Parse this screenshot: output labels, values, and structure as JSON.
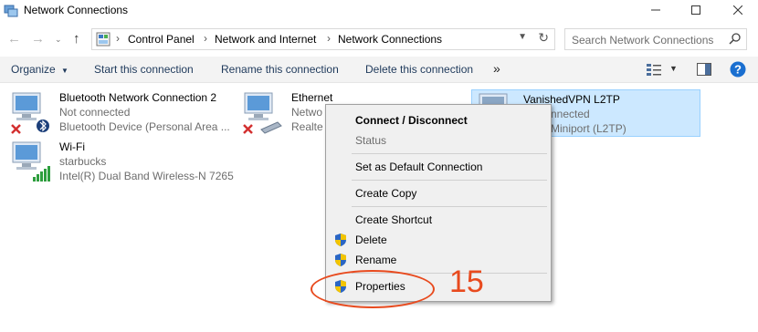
{
  "window": {
    "title": "Network Connections"
  },
  "breadcrumb": [
    "Control Panel",
    "Network and Internet",
    "Network Connections"
  ],
  "search": {
    "placeholder": "Search Network Connections",
    "value": ""
  },
  "toolbar": {
    "organize": "Organize",
    "start": "Start this connection",
    "rename": "Rename this connection",
    "delete": "Delete this connection",
    "more": "»"
  },
  "connections": [
    {
      "name": "Bluetooth Network Connection 2",
      "status": "Not connected",
      "device": "Bluetooth Device (Personal Area ..."
    },
    {
      "name": "Ethernet",
      "status": "Netwo",
      "device": "Realte"
    },
    {
      "name": "VanishedVPN L2TP",
      "status": "nnected",
      "device": "Miniport (L2TP)"
    },
    {
      "name": "Wi-Fi",
      "status": "starbucks",
      "device": "Intel(R) Dual Band Wireless-N 7265"
    }
  ],
  "context_menu": {
    "connect": "Connect / Disconnect",
    "status": "Status",
    "set_default": "Set as Default Connection",
    "create_copy": "Create Copy",
    "create_shortcut": "Create Shortcut",
    "delete": "Delete",
    "rename": "Rename",
    "properties": "Properties"
  },
  "annotation": {
    "step": "15"
  },
  "colors": {
    "annotation": "#e84a1e",
    "selection": "#cce8ff",
    "help": "#1a6fd0"
  }
}
